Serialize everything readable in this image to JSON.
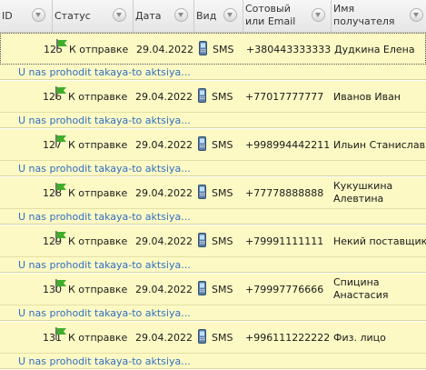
{
  "columns": {
    "id": "ID",
    "status": "Статус",
    "date": "Дата",
    "type": "Вид",
    "contact": "Сотовый или Email",
    "recipient": "Имя получателя"
  },
  "rows": [
    {
      "id": "125",
      "status": "К отправке",
      "date": "29.04.2022",
      "type": "SMS",
      "contact": "+380443333333",
      "recipient": "Дудкина Елена",
      "message": "U nas prohodit takaya-to aktsiya..."
    },
    {
      "id": "126",
      "status": "К отправке",
      "date": "29.04.2022",
      "type": "SMS",
      "contact": "+77017777777",
      "recipient": "Иванов Иван",
      "message": "U nas prohodit takaya-to aktsiya..."
    },
    {
      "id": "127",
      "status": "К отправке",
      "date": "29.04.2022",
      "type": "SMS",
      "contact": "+998994442211",
      "recipient": "Ильин Станислав",
      "message": "U nas prohodit takaya-to aktsiya..."
    },
    {
      "id": "128",
      "status": "К отправке",
      "date": "29.04.2022",
      "type": "SMS",
      "contact": "+77778888888",
      "recipient": "Кукушкина Алевтина",
      "message": "U nas prohodit takaya-to aktsiya..."
    },
    {
      "id": "129",
      "status": "К отправке",
      "date": "29.04.2022",
      "type": "SMS",
      "contact": "+79991111111",
      "recipient": "Некий поставщик",
      "message": "U nas prohodit takaya-to aktsiya..."
    },
    {
      "id": "130",
      "status": "К отправке",
      "date": "29.04.2022",
      "type": "SMS",
      "contact": "+79997776666",
      "recipient": "Спицина Анастасия",
      "message": "U nas prohodit takaya-to aktsiya..."
    },
    {
      "id": "131",
      "status": "К отправке",
      "date": "29.04.2022",
      "type": "SMS",
      "contact": "+996111222222",
      "recipient": "Физ. лицо",
      "message": "U nas prohodit takaya-to aktsiya..."
    }
  ],
  "colors": {
    "row_bg": "#fdf9c4",
    "message_link": "#2f6fc2",
    "flag": "#3fae2a"
  }
}
